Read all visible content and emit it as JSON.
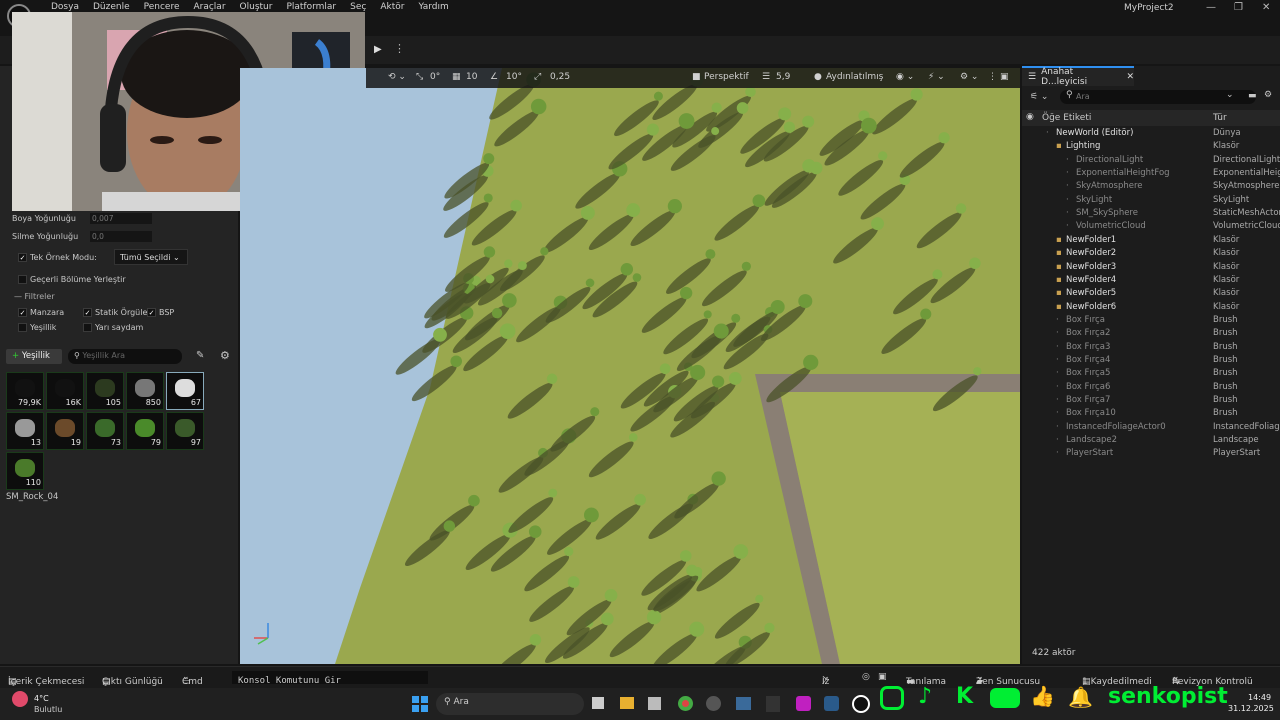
{
  "menubar": {
    "items": [
      "Dosya",
      "Düzenle",
      "Pencere",
      "Araçlar",
      "Oluştur",
      "Platformlar",
      "Seç",
      "Aktör",
      "Yardım"
    ],
    "project_title": "MyProject2",
    "min": "—",
    "max": "❐",
    "close": "✕"
  },
  "viewport_toolbar": {
    "rotate_snap": "0°",
    "grid_snap": "10",
    "angle_snap": "10°",
    "scale_snap": "0,25",
    "view_mode": "Perspektif",
    "camera_speed": "5,9",
    "lighting": "Aydınlatılmış"
  },
  "foliage": {
    "paint_density_label": "Boya Yoğunluğu",
    "paint_density_value": "0,007",
    "erase_density_label": "Silme Yoğunluğu",
    "erase_density_value": "0,0",
    "single_instance_label": "Tek Örnek Modu:",
    "single_instance_value": "Tümü Seçildi",
    "current_level_label": "Geçerli Bölüme Yerleştir",
    "filters_label": "Filtreler",
    "filters": {
      "landscape": "Manzara",
      "static_meshes": "Statik Örgüler",
      "bsp": "BSP",
      "foliage": "Yeşillik",
      "translucent": "Yarı saydam"
    },
    "add_button": "Yeşillik",
    "search_placeholder": "Yeşillik Ara",
    "thumb_counts": [
      "79,9K",
      "16K",
      "105",
      "850",
      "67",
      "13",
      "19",
      "73",
      "79",
      "97",
      "110"
    ],
    "selected_asset": "SM_Rock_04"
  },
  "outliner": {
    "tab_title": "Anahat D...leyicisi",
    "search_placeholder": "Ara",
    "col_label": "Öğe Etiketi",
    "col_type": "Tür",
    "rows": [
      {
        "name": "NewWorld (Editör)",
        "type": "Dünya"
      },
      {
        "name": "Lighting",
        "type": "Klasör"
      },
      {
        "name": "DirectionalLight",
        "type": "DirectionalLight"
      },
      {
        "name": "ExponentialHeightFog",
        "type": "ExponentialHeightF"
      },
      {
        "name": "SkyAtmosphere",
        "type": "SkyAtmosphere"
      },
      {
        "name": "SkyLight",
        "type": "SkyLight"
      },
      {
        "name": "SM_SkySphere",
        "type": "StaticMeshActor"
      },
      {
        "name": "VolumetricCloud",
        "type": "VolumetricCloud"
      },
      {
        "name": "NewFolder1",
        "type": "Klasör"
      },
      {
        "name": "NewFolder2",
        "type": "Klasör"
      },
      {
        "name": "NewFolder3",
        "type": "Klasör"
      },
      {
        "name": "NewFolder4",
        "type": "Klasör"
      },
      {
        "name": "NewFolder5",
        "type": "Klasör"
      },
      {
        "name": "NewFolder6",
        "type": "Klasör"
      },
      {
        "name": "Box Fırça",
        "type": "Brush"
      },
      {
        "name": "Box Fırça2",
        "type": "Brush"
      },
      {
        "name": "Box Fırça3",
        "type": "Brush"
      },
      {
        "name": "Box Fırça4",
        "type": "Brush"
      },
      {
        "name": "Box Fırça5",
        "type": "Brush"
      },
      {
        "name": "Box Fırça6",
        "type": "Brush"
      },
      {
        "name": "Box Fırça7",
        "type": "Brush"
      },
      {
        "name": "Box Fırça10",
        "type": "Brush"
      },
      {
        "name": "InstancedFoliageActor0",
        "type": "InstancedFoliage"
      },
      {
        "name": "Landscape2",
        "type": "Landscape"
      },
      {
        "name": "PlayerStart",
        "type": "PlayerStart"
      }
    ],
    "actor_count": "422 aktör"
  },
  "statusbar": {
    "content_drawer": "İçerik Çekmecesi",
    "output_log": "Çıktı Günlüğü",
    "cmd": "Cmd",
    "console_placeholder": "Konsol Komutunu Gir",
    "trace": "İz",
    "diagnostics": "Tanılama",
    "zen_server": "Zen Sunucusu",
    "unsaved": "1 Kaydedilmedi",
    "revision_control": "Revizyon Kontrolü"
  },
  "taskbar": {
    "temperature": "4°C",
    "weather": "Bulutlu",
    "search": "Ara",
    "time": "14:49",
    "date": "31.12.2025"
  },
  "overlay": {
    "channel_name": "senkopist"
  },
  "colors": {
    "accent": "#2f8ff0",
    "grass": "#9aa84e",
    "sky": "#a8c3da",
    "social_green": "#00ee33"
  }
}
